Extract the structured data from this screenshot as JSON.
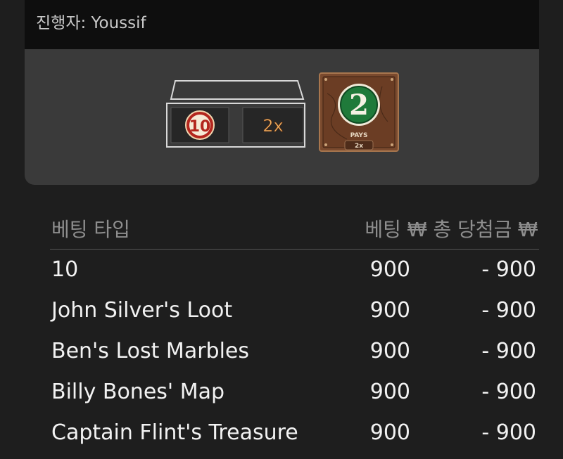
{
  "header": {
    "dealer_text": "진행자: Youssif"
  },
  "result": {
    "chest_chips": [
      "10",
      "2x"
    ],
    "card_number": "2",
    "card_pays_label": "PAYS",
    "card_multiplier": "2x"
  },
  "table": {
    "col_type": "베팅 타입",
    "col_bet": "베팅",
    "col_total": "총 당첨금",
    "currency": "₩",
    "rows": [
      {
        "name": "10",
        "bet": "900",
        "win": "- 900"
      },
      {
        "name": "John Silver's Loot",
        "bet": "900",
        "win": "- 900"
      },
      {
        "name": "Ben's Lost Marbles",
        "bet": "900",
        "win": "- 900"
      },
      {
        "name": "Billy Bones' Map",
        "bet": "900",
        "win": "- 900"
      },
      {
        "name": "Captain Flint's Treasure",
        "bet": "900",
        "win": "- 900"
      }
    ]
  },
  "colors": {
    "background": "#1e1e1e",
    "panel": "#3a3a3a",
    "header_bar": "#0e0e0e",
    "chip_red": "#b3261e",
    "card_green": "#1f7a3a",
    "card_brown": "#7a4a2e"
  }
}
